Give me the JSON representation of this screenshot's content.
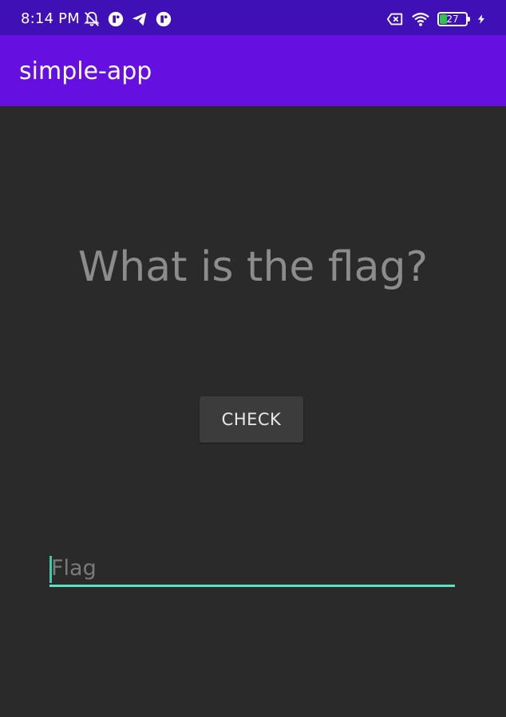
{
  "status_bar": {
    "time": "8:14 PM",
    "battery_level": "27",
    "battery_fraction": 0.27,
    "left_icons": [
      "mute-alarm-icon",
      "app-badge-icon",
      "telegram-icon",
      "app-badge-icon"
    ],
    "right_icons": [
      "sim-off-icon",
      "wifi-icon",
      "battery-icon",
      "charging-icon"
    ]
  },
  "app_bar": {
    "title": "simple-app",
    "color": "#6510e0"
  },
  "main": {
    "question": "What is the flag?",
    "check_button_label": "CHECK",
    "flag_input": {
      "value": "",
      "placeholder": "Flag"
    }
  },
  "colors": {
    "status_bar": "#3e10b6",
    "background": "#2a2a2a",
    "accent": "#5fe0c0"
  }
}
